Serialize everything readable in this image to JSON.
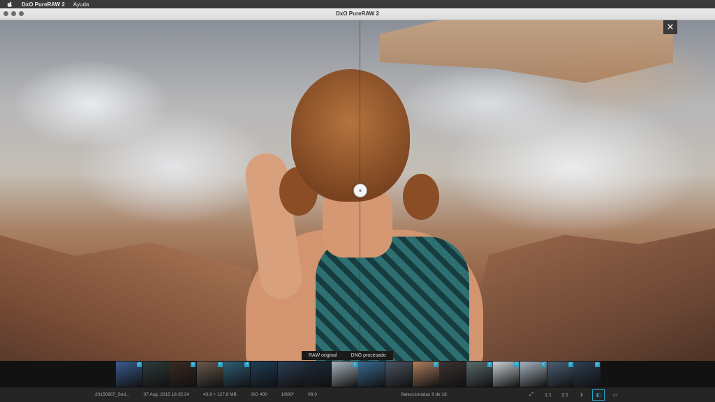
{
  "menubar": {
    "app": "DxO PureRAW 2",
    "menu": "Ayuda"
  },
  "window": {
    "title": "DxO PureRAW 2"
  },
  "viewer": {
    "close_glyph": "✕",
    "handle_glyph": "⏸",
    "left_label": "RAW original",
    "right_label": "DNG procesado"
  },
  "filmstrip": {
    "thumbs": [
      {
        "color": "#3a5d8f",
        "checked": true
      },
      {
        "color": "#2e3b3a",
        "checked": false
      },
      {
        "color": "#3b2a22",
        "checked": true
      },
      {
        "color": "#6a5a4c",
        "checked": true
      },
      {
        "color": "#2f5e74",
        "checked": true
      },
      {
        "color": "#1f3e57",
        "checked": false
      },
      {
        "color": "#2c3d55",
        "checked": false
      },
      {
        "color": "#1e2a3a",
        "checked": false
      },
      {
        "color": "#a8b4c0",
        "checked": true
      },
      {
        "color": "#3a6a92",
        "checked": false
      },
      {
        "color": "#4a5563",
        "checked": false
      },
      {
        "color": "#b07f5e",
        "checked": true
      },
      {
        "color": "#3a3430",
        "checked": false
      },
      {
        "color": "#5b6c6e",
        "checked": true
      },
      {
        "color": "#c8cfd4",
        "checked": true
      },
      {
        "color": "#a6b3bf",
        "checked": true
      },
      {
        "color": "#4a5f74",
        "checked": true
      },
      {
        "color": "#2f3d52",
        "checked": true
      }
    ]
  },
  "status": {
    "filename": "20150807_Sed...",
    "date": "07 Aug. 2015 18:35:24",
    "size": "43.9 + 127.8 MB",
    "iso": "ISO 400",
    "shutter": "1/800\"",
    "aperture": "f/8.0",
    "selected": "Seleccionadas 9 de 18",
    "zoom_fit": "⤢",
    "zoom_1": "1:1",
    "zoom_2": "2:1",
    "stepper": "⇕",
    "view_split": "◧",
    "view_single": "▭"
  }
}
